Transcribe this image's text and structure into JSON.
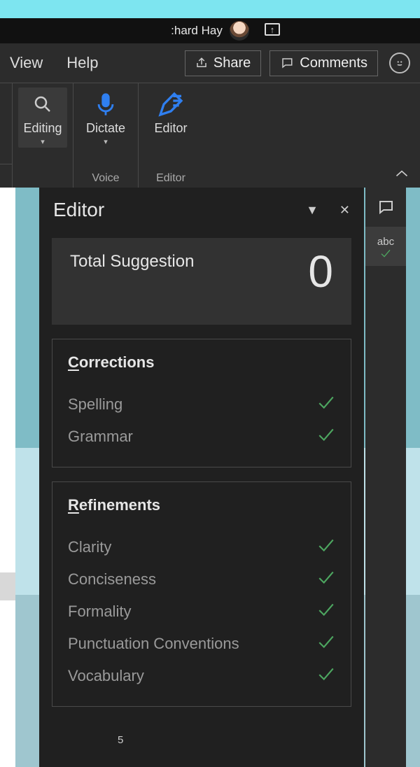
{
  "titlebar": {
    "username": ":hard Hay"
  },
  "tabs": {
    "view": "View",
    "help": "Help"
  },
  "actions": {
    "share": "Share",
    "comments": "Comments"
  },
  "ribbon": {
    "editing": {
      "label": "Editing"
    },
    "dictate": {
      "label": "Dictate",
      "group": "Voice"
    },
    "editor": {
      "label": "Editor",
      "group": "Editor"
    }
  },
  "editor_pane": {
    "title": "Editor",
    "summary": {
      "label": "Total Suggestion",
      "value": "0"
    },
    "corrections": {
      "heading": "Corrections",
      "heading_ul": "C",
      "heading_rest": "orrections",
      "items": [
        "Spelling",
        "Grammar"
      ]
    },
    "refinements": {
      "heading": "Refinements",
      "heading_ul": "R",
      "heading_rest": "efinements",
      "items": [
        "Clarity",
        "Conciseness",
        "Formality",
        "Punctuation Conventions",
        "Vocabulary"
      ]
    },
    "page_number": "5"
  },
  "rstrip": {
    "abc": "abc"
  }
}
